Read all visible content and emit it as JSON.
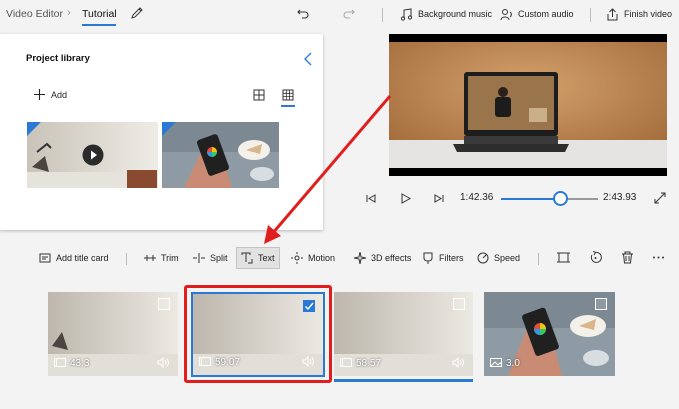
{
  "header": {
    "app_name": "Video Editor",
    "project_title": "Tutorial",
    "background_music_label": "Background music",
    "custom_audio_label": "Custom audio",
    "finish_video_label": "Finish video"
  },
  "library": {
    "title": "Project library",
    "add_label": "Add"
  },
  "player": {
    "current_time": "1:42.36",
    "total_time": "2:43.93",
    "progress_fraction": 0.62
  },
  "toolbar": {
    "add_title_card": "Add title card",
    "trim": "Trim",
    "split": "Split",
    "text": "Text",
    "motion": "Motion",
    "effects_3d": "3D effects",
    "filters": "Filters",
    "speed": "Speed"
  },
  "storyboard": {
    "clips": [
      {
        "duration": "43.3",
        "type": "video",
        "selected": false
      },
      {
        "duration": "59.07",
        "type": "video",
        "selected": true
      },
      {
        "duration": "58.57",
        "type": "video",
        "selected": false
      },
      {
        "duration": "3.0",
        "type": "image",
        "selected": false
      }
    ]
  },
  "colors": {
    "accent": "#2a7ad5",
    "annotation_red": "#e01e1e"
  }
}
